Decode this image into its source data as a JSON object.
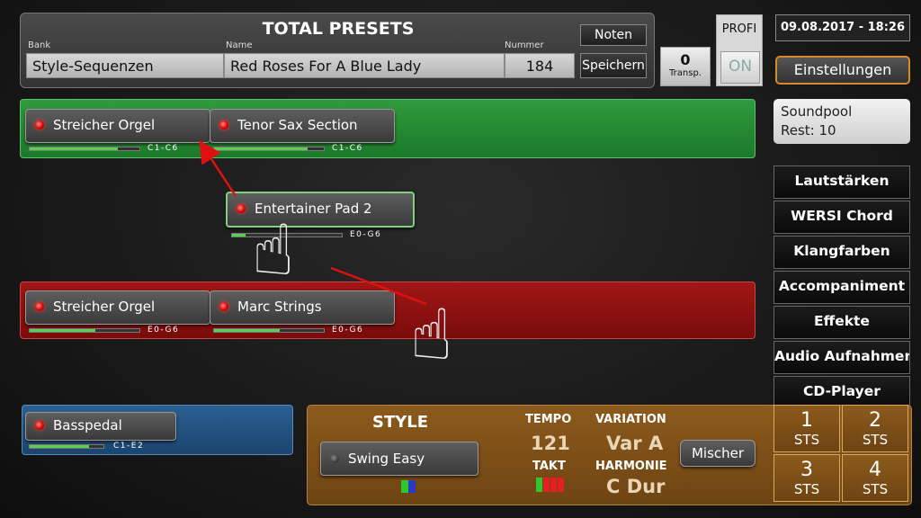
{
  "presets": {
    "title": "TOTAL PRESETS",
    "bank_label": "Bank",
    "name_label": "Name",
    "number_label": "Nummer",
    "bank": "Style-Sequenzen",
    "name": "Red Roses For A Blue Lady",
    "number": "184",
    "noten": "Noten",
    "speichern": "Speichern"
  },
  "transp": {
    "value": "0",
    "label": "Transp."
  },
  "profi": {
    "label": "PROFI",
    "state": "ON"
  },
  "datetime": "09.08.2017 - 18:26",
  "settings": "Einstellungen",
  "soundpool": {
    "line1": "Soundpool",
    "line2": "Rest: 10"
  },
  "menu": [
    "Lautstärken",
    "WERSI Chord",
    "Klangfarben",
    "Accompaniment",
    "Effekte",
    "Audio Aufnahmen",
    "CD-Player"
  ],
  "upper": [
    {
      "label": "Streicher Orgel",
      "range": "C1-C6",
      "level": 0.8
    },
    {
      "label": "Tenor Sax Section",
      "range": "C1-C6",
      "level": 0.85
    }
  ],
  "dragged": {
    "label": "Entertainer Pad 2",
    "range": "E0-G6",
    "level": 0.12
  },
  "lower": [
    {
      "label": "Streicher Orgel",
      "range": "E0-G6",
      "level": 0.6
    },
    {
      "label": "Marc Strings",
      "range": "E0-G6",
      "level": 0.6
    }
  ],
  "pedal": {
    "label": "Basspedal",
    "range": "C1-E2",
    "level": 0.8
  },
  "style": {
    "heading": "STYLE",
    "name": "Swing Easy",
    "tempo_label": "TEMPO",
    "tempo": "121",
    "takt_label": "TAKT",
    "variation_label": "VARIATION",
    "variation": "Var A",
    "harmonie_label": "HARMONIE",
    "harmonie": "C Dur",
    "mixer": "Mischer"
  },
  "sts": [
    {
      "num": "1",
      "label": "STS"
    },
    {
      "num": "2",
      "label": "STS"
    },
    {
      "num": "3",
      "label": "STS"
    },
    {
      "num": "4",
      "label": "STS"
    }
  ],
  "colors": {
    "upper": "#2f9a3e",
    "lower": "#a01616",
    "pedal": "#2a5f92",
    "style": "#8c5a1c",
    "accent": "#d68a2e",
    "arrow": "#e01010"
  },
  "icons": [
    "led-icon",
    "hand-pointer-icon",
    "drag-arrow-icon"
  ]
}
